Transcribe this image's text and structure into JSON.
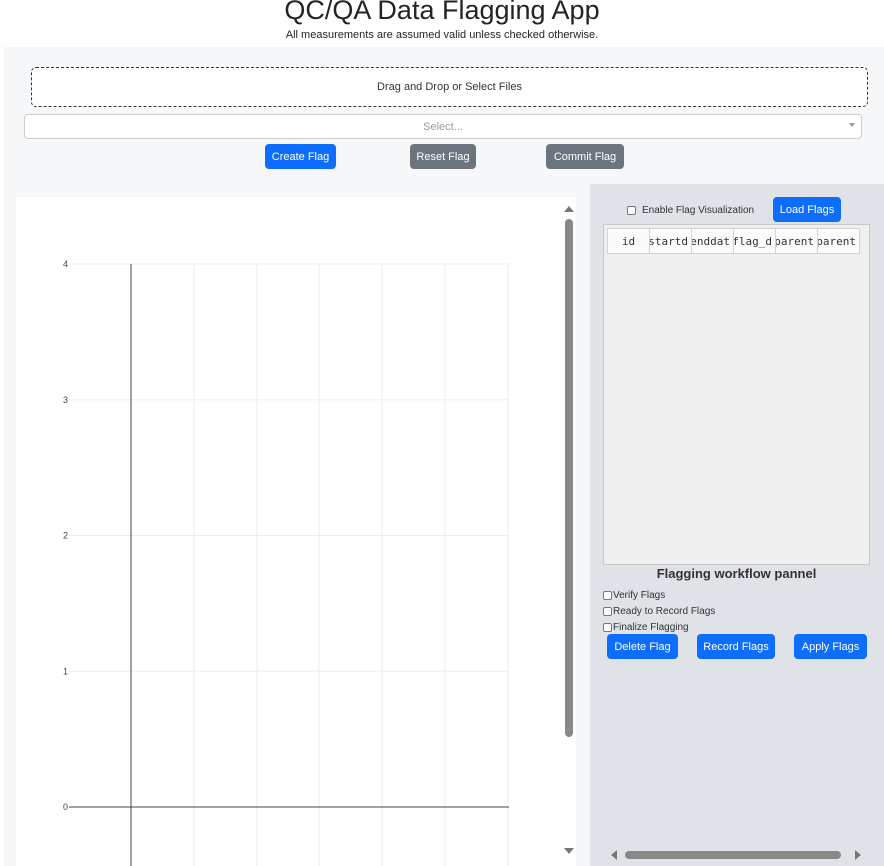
{
  "app": {
    "title": "QC/QA Data Flagging App",
    "subtitle": "All measurements are assumed valid unless checked otherwise."
  },
  "upload": {
    "label": "Drag and Drop or Select Files"
  },
  "select": {
    "placeholder": "Select..."
  },
  "top_buttons": {
    "create": "Create Flag",
    "reset": "Reset Flag",
    "commit": "Commit Flag"
  },
  "right_panel": {
    "enable_label": "Enable Flag Visualization",
    "load_button": "Load Flags",
    "table_columns": [
      "id",
      "startd",
      "enddat",
      "flag_d",
      "parent",
      "parent"
    ],
    "workflow_title": "Flagging workflow pannel",
    "checkboxes": [
      "Verify Flags",
      "Ready to Record Flags",
      "Finalize Flagging"
    ],
    "buttons": {
      "delete": "Delete Flag",
      "record": "Record Flags",
      "apply": "Apply Flags"
    }
  },
  "colors": {
    "primary": "#0d6efd",
    "secondary": "#6c757d",
    "panel_bg": "#dfe2e7"
  },
  "chart_data": {
    "type": "line",
    "y_ticks": [
      "0",
      "1",
      "2",
      "3",
      "4"
    ],
    "ylim": [
      0,
      4
    ],
    "series": [],
    "grid": true
  }
}
